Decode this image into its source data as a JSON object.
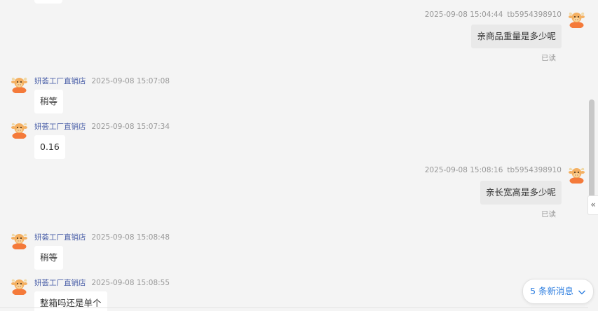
{
  "messages": [
    {
      "sender": "tb5954398910",
      "time": "2025-09-08 15:04:44",
      "text": "亲商品重量是多少呢",
      "status": "已读"
    },
    {
      "sender": "妍荟工厂直销店",
      "time": "2025-09-08 15:07:08",
      "text": "稍等"
    },
    {
      "sender": "妍荟工厂直销店",
      "time": "2025-09-08 15:07:34",
      "text": "0.16"
    },
    {
      "sender": "tb5954398910",
      "time": "2025-09-08 15:08:16",
      "text": "亲长宽高是多少呢",
      "status": "已读"
    },
    {
      "sender": "妍荟工厂直销店",
      "time": "2025-09-08 15:08:48",
      "text": "稍等"
    },
    {
      "sender": "妍荟工厂直销店",
      "time": "2025-09-08 15:08:55",
      "text": "整箱吗还是单个"
    }
  ],
  "new_messages_label": "5 条新消息",
  "collapse_label": "«",
  "colors": {
    "shop_name": "#4a5fa8",
    "new_messages": "#2f7fe0",
    "self_bubble": "#e9e9e9",
    "other_bubble": "#ffffff"
  }
}
